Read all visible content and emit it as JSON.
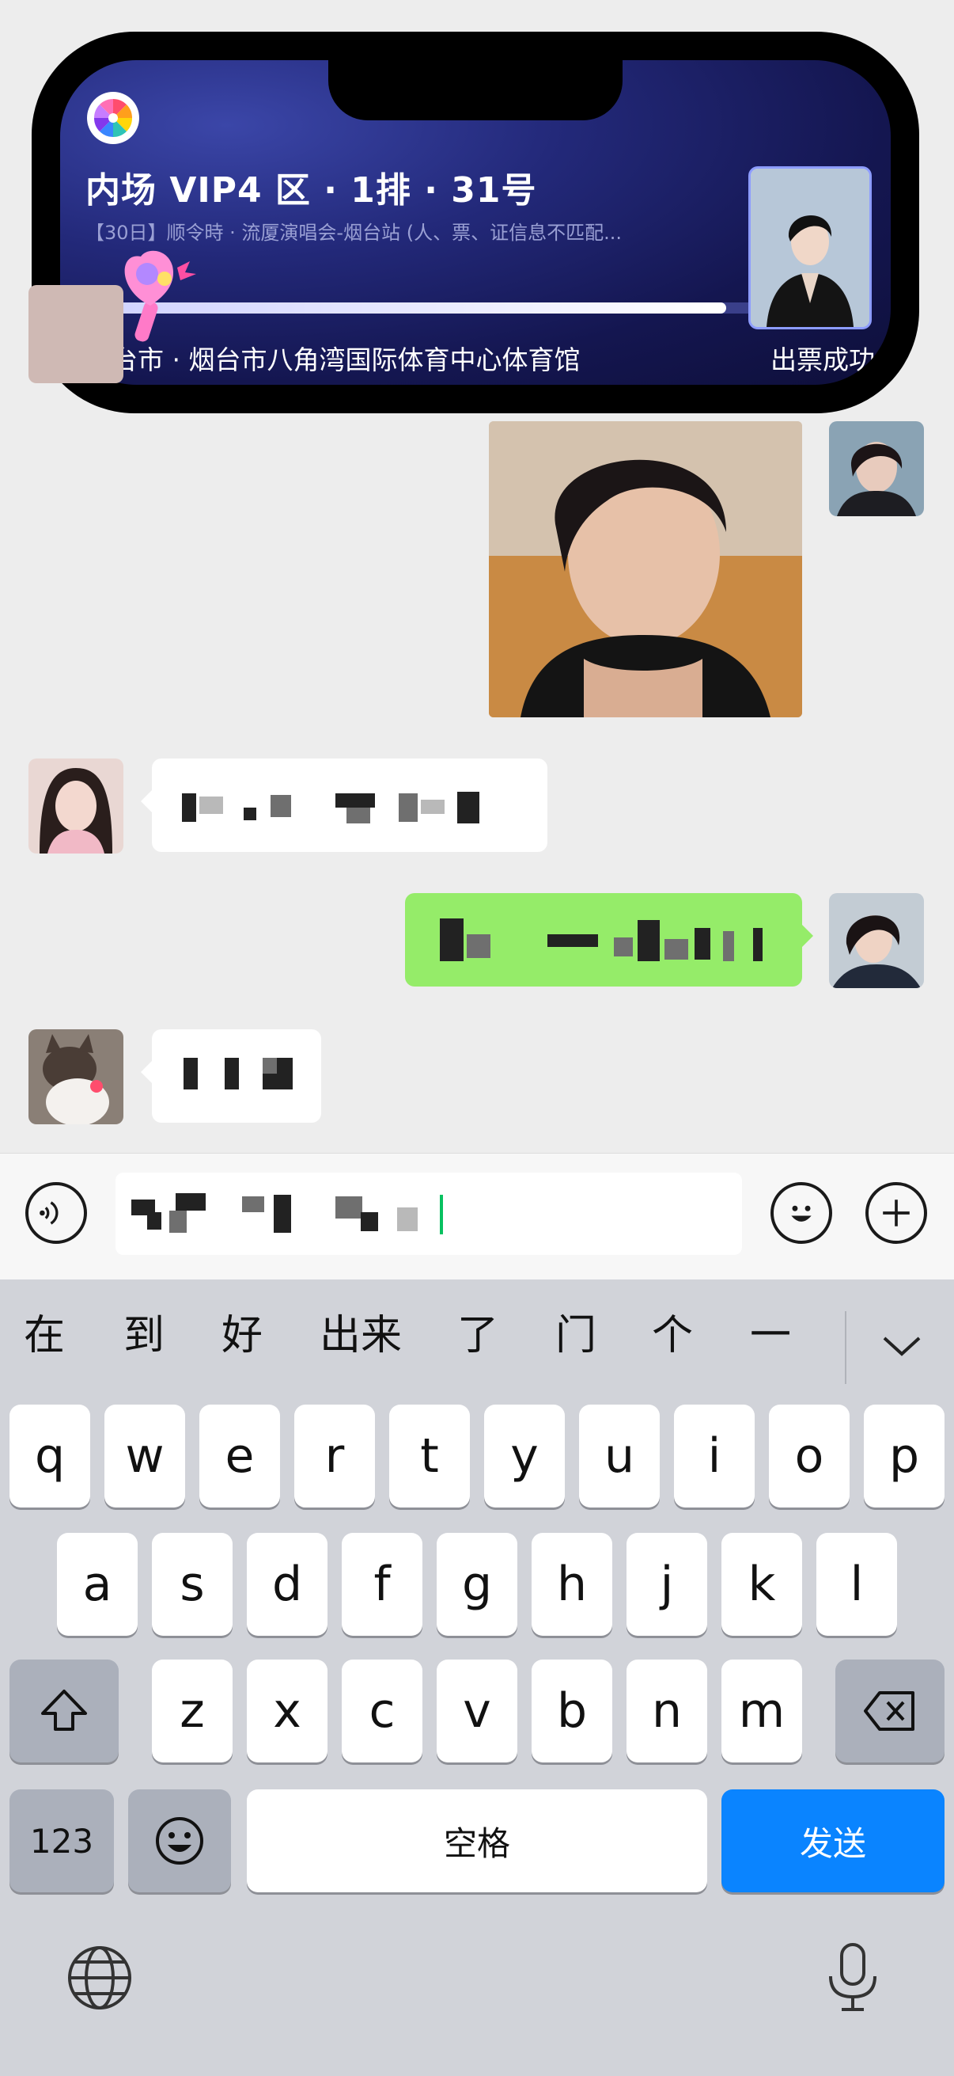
{
  "live_activity": {
    "seat": "内场 VIP4 区 · 1排 · 31号",
    "event": "【30日】顺令時 · 流厦演唱会-烟台站 (人、票、证信息不匹配...",
    "venue": "烟台市 · 烟台市八角湾国际体育中心体育馆",
    "status": "出票成功",
    "progress": 0.92
  },
  "input": {
    "voice_icon": "voice-wave-icon",
    "emoji_icon": "smiley-icon",
    "plus_icon": "plus-circle-icon"
  },
  "keyboard": {
    "candidates": [
      "在",
      "到",
      "好",
      "出来",
      "了",
      "门",
      "个",
      "一"
    ],
    "row1": [
      "q",
      "w",
      "e",
      "r",
      "t",
      "y",
      "u",
      "i",
      "o",
      "p"
    ],
    "row2": [
      "a",
      "s",
      "d",
      "f",
      "g",
      "h",
      "j",
      "k",
      "l"
    ],
    "row3": [
      "z",
      "x",
      "c",
      "v",
      "b",
      "n",
      "m"
    ],
    "numbers_label": "123",
    "space_label": "空格",
    "send_label": "发送",
    "send_color": "#0a84ff"
  }
}
